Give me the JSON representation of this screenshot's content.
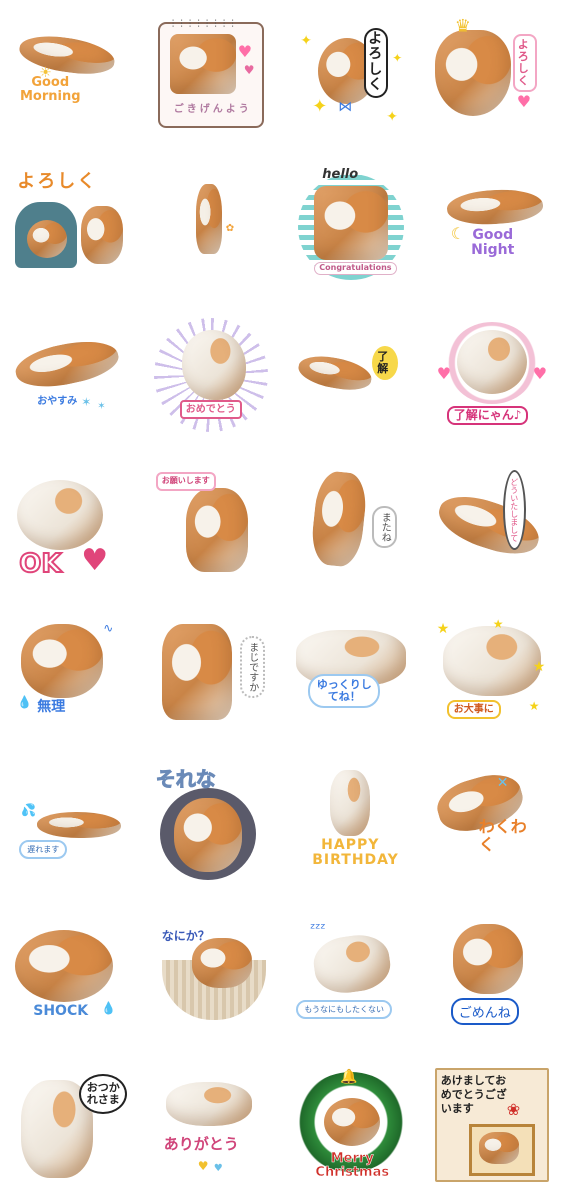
{
  "stickers": [
    {
      "text": "Good Morning"
    },
    {
      "text": "ごきげんよう"
    },
    {
      "text": "よろしく"
    },
    {
      "text": "よろしく"
    },
    {
      "text": "よろしく"
    },
    {
      "text": ""
    },
    {
      "text": "hello",
      "sub": "Congratulations"
    },
    {
      "text": "Good Night"
    },
    {
      "text": "おやすみ"
    },
    {
      "text": "おめでとう"
    },
    {
      "text": "了解"
    },
    {
      "text": "了解にゃん♪"
    },
    {
      "text": "OK"
    },
    {
      "text": "お願いします"
    },
    {
      "text": "またね"
    },
    {
      "text": "どういたしまして"
    },
    {
      "text": "無理"
    },
    {
      "text": "まじですか"
    },
    {
      "text": "ゆっくりしてね！"
    },
    {
      "text": "お大事に"
    },
    {
      "text": "遅れます"
    },
    {
      "text": "それな"
    },
    {
      "text": "HAPPY BIRTHDAY"
    },
    {
      "text": "わくわく"
    },
    {
      "text": "SHOCK"
    },
    {
      "text": "なにか？"
    },
    {
      "text": "もうなにもしたくない"
    },
    {
      "text": "ごめんね"
    },
    {
      "text": "おつかれさま"
    },
    {
      "text": "ありがとう"
    },
    {
      "text": "Merry Christmas"
    },
    {
      "text": "あけましておめでとうございます"
    }
  ]
}
